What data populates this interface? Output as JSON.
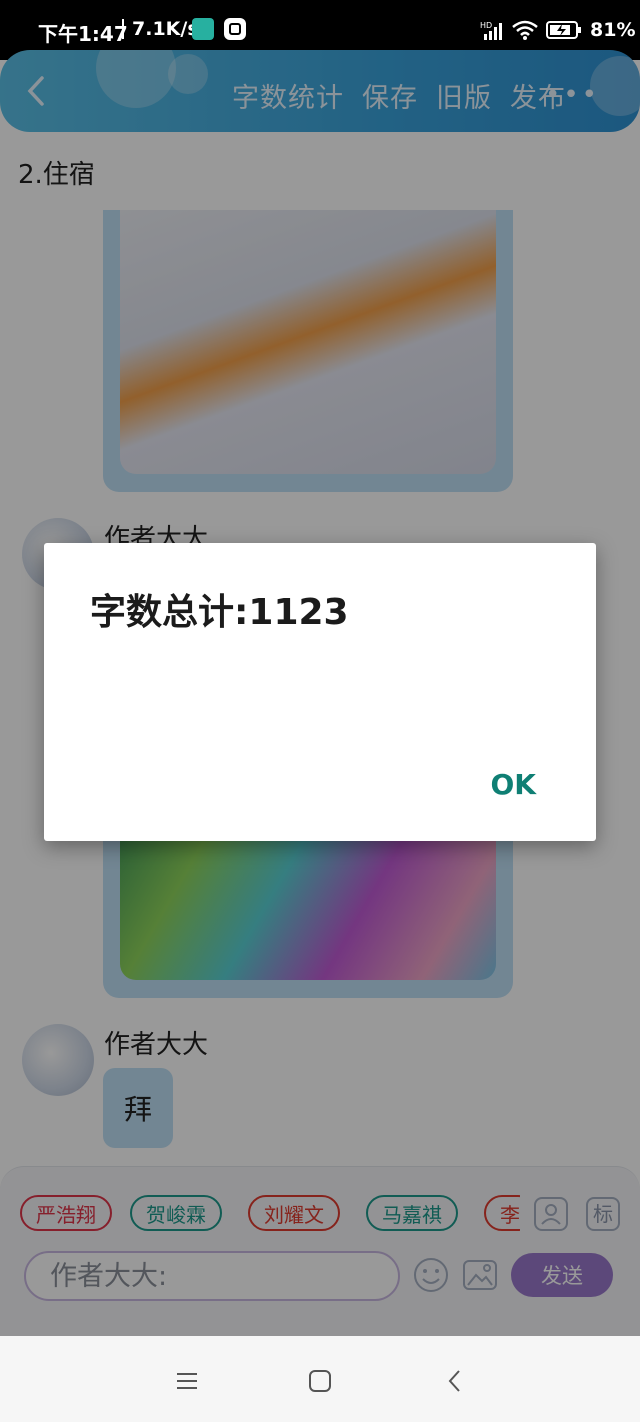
{
  "status_bar": {
    "time": "下午1:47",
    "network_speed": "7.1K/s",
    "signal_label": "HD",
    "battery_percent": "81%"
  },
  "app_bar": {
    "actions": [
      "字数统计",
      "保存",
      "旧版",
      "发布"
    ],
    "more_label": "•••"
  },
  "content": {
    "section_heading": "2.住宿",
    "messages": [
      {
        "author": "作者大大"
      },
      {
        "author": "作者大大",
        "text": "拜"
      }
    ]
  },
  "composer": {
    "chips": [
      {
        "label": "严浩翔",
        "color": "#e0354a"
      },
      {
        "label": "贺峻霖",
        "color": "#1d9a8c"
      },
      {
        "label": "刘耀文",
        "color": "#e03b2f"
      },
      {
        "label": "马嘉祺",
        "color": "#1d9a8c"
      },
      {
        "label": "李",
        "color": "#e03b2f"
      }
    ],
    "tag_label": "标",
    "input_placeholder": "作者大大:",
    "send_label": "发送"
  },
  "dialog": {
    "message": "字数总计:1123",
    "ok_label": "OK"
  }
}
